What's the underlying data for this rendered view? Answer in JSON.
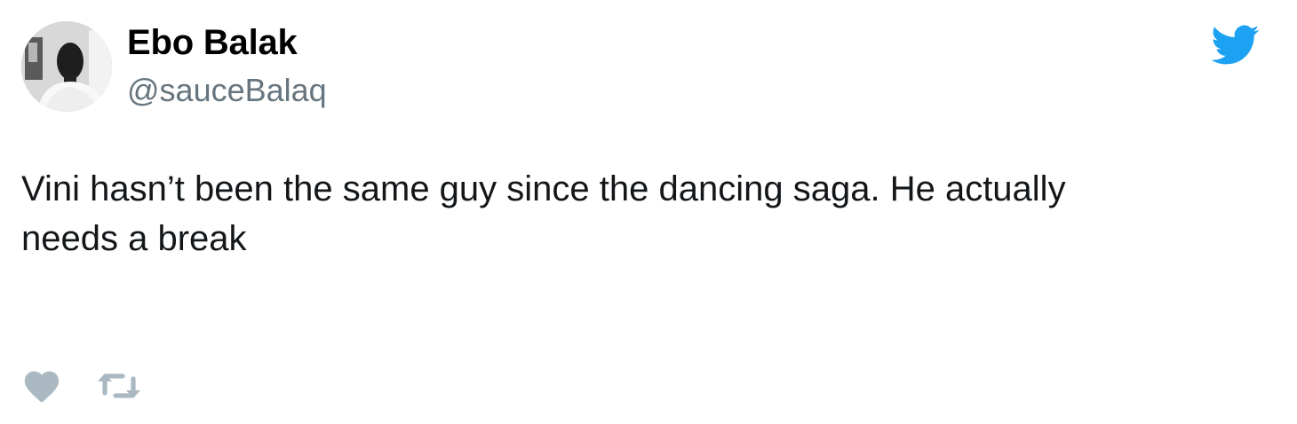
{
  "tweet": {
    "author": {
      "name": "Ebo Balak",
      "handle": "@sauceBalaq",
      "avatar_icon": "user-avatar"
    },
    "text_lines": [
      "Vini hasn’t been the same guy since the dancing saga. He actually",
      "needs a break"
    ],
    "actions": {
      "like_icon": "heart-icon",
      "retweet_icon": "retweet-icon"
    },
    "brand_icon": "twitter-bird-icon"
  },
  "colors": {
    "text": "#14171a",
    "name": "#000000",
    "handle": "#66757f",
    "brand": "#1da1f2",
    "action": "#aab8c2"
  }
}
